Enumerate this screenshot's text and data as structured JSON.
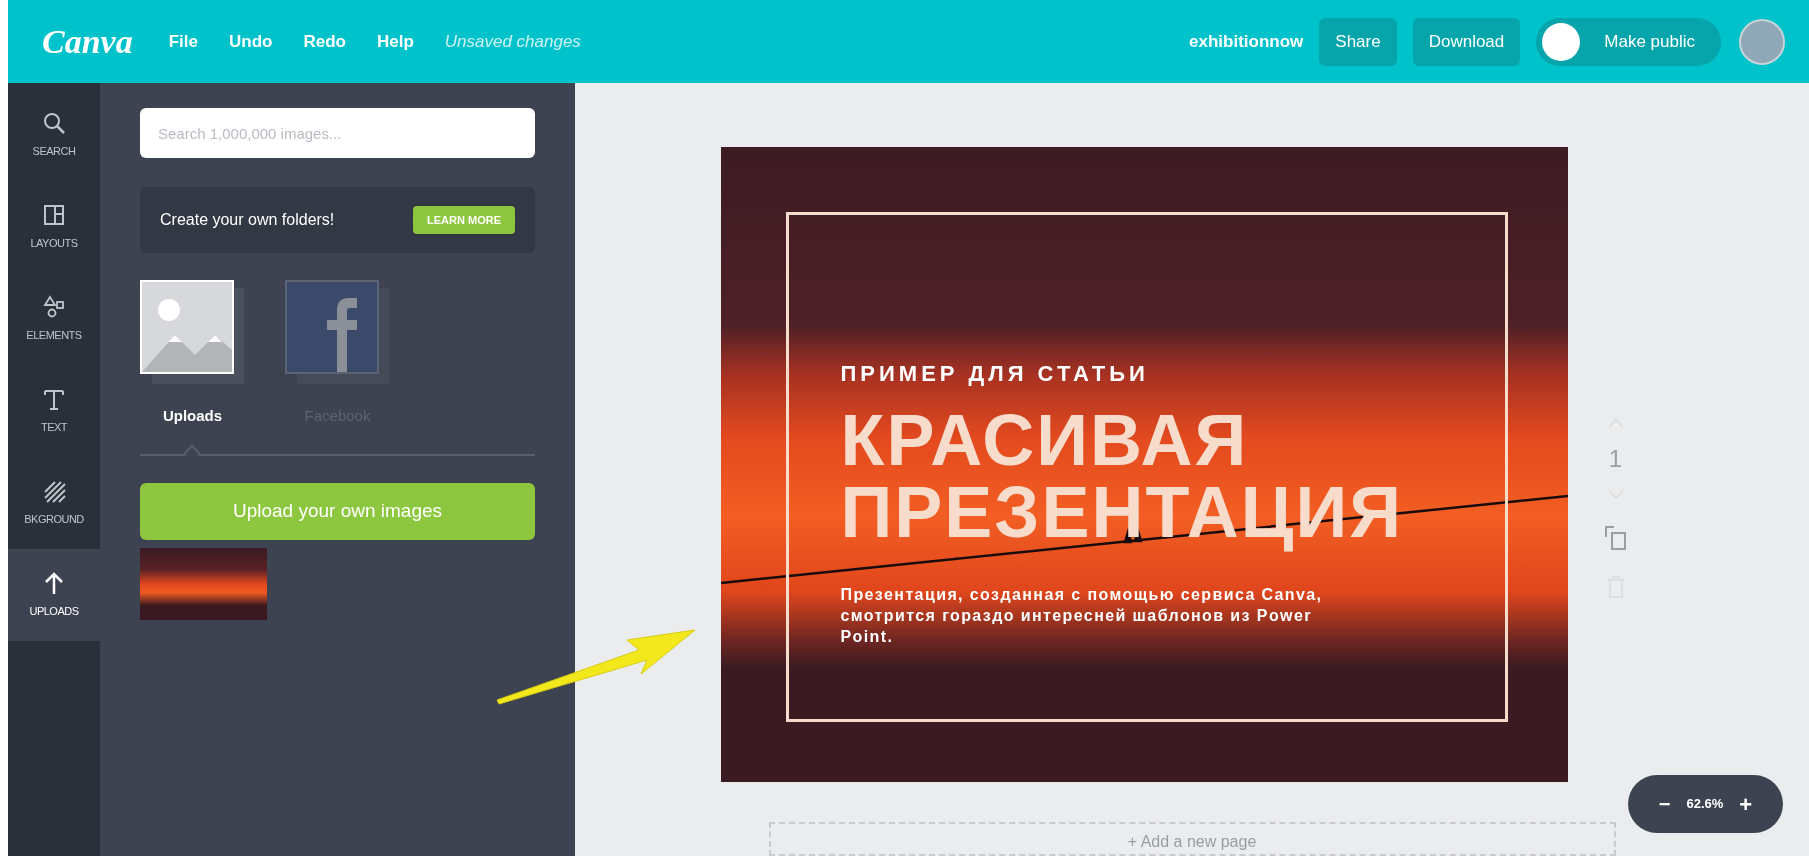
{
  "topbar": {
    "logo": "Canva",
    "menu": [
      {
        "label": "File",
        "kind": "menu"
      },
      {
        "label": "Undo",
        "kind": "menu"
      },
      {
        "label": "Redo",
        "kind": "menu"
      },
      {
        "label": "Help",
        "kind": "menu"
      },
      {
        "label": "Unsaved changes",
        "kind": "status"
      }
    ],
    "user": "exhibitionnow",
    "buttons": [
      "Share",
      "Download"
    ],
    "public_toggle": {
      "label": "Make public",
      "on": false
    }
  },
  "sidebar": {
    "items": [
      {
        "label": "SEARCH",
        "selected": false
      },
      {
        "label": "LAYOUTS",
        "selected": false
      },
      {
        "label": "ELEMENTS",
        "selected": false
      },
      {
        "label": "TEXT",
        "selected": false
      },
      {
        "label": "BKGROUND",
        "selected": false
      },
      {
        "label": "UPLOADS",
        "selected": true
      }
    ]
  },
  "panel": {
    "search": {
      "placeholder": "Search 1,000,000 images..."
    },
    "promo": {
      "text": "Create your own folders!",
      "button": "LEARN MORE"
    },
    "sources": [
      {
        "label": "Uploads",
        "kind": "uploads",
        "selected": true
      },
      {
        "label": "Facebook",
        "kind": "facebook",
        "selected": false
      }
    ],
    "upload_button": "Upload your own images"
  },
  "slide": {
    "kicker": "ПРИМЕР ДЛЯ СТАТЬИ",
    "title_lines": [
      "КРАСИВАЯ",
      "ПРЕЗЕНТАЦИЯ"
    ],
    "body": "Презентация, созданная с помощью сервиса Canva, смотрится гораздо интересней шаблонов из Power Point."
  },
  "page_number": "1",
  "add_page": "+ Add a new page",
  "zoom": {
    "minus": "−",
    "value": "62.6%",
    "plus": "+"
  }
}
